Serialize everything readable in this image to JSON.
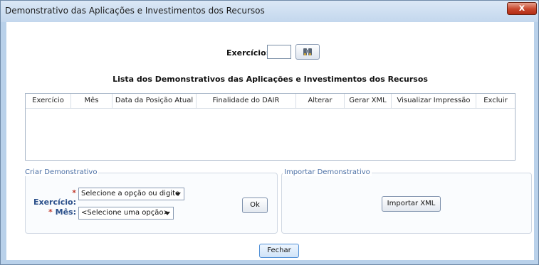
{
  "window": {
    "title": "Demonstrativo das Aplicações e Investimentos dos Recursos",
    "close_label": "x"
  },
  "filter": {
    "exercicio_label": "Exercício:",
    "exercicio_value": "",
    "search_icon": "binoculars-icon"
  },
  "list": {
    "title": "Lista dos Demonstrativos das Aplicações e Investimentos dos Recursos",
    "columns": [
      "Exercício",
      "Mês",
      "Data da Posição Atual",
      "Finalidade do DAIR",
      "Alterar",
      "Gerar XML",
      "Visualizar Impressão",
      "Excluir"
    ],
    "rows": []
  },
  "criar": {
    "title": "Criar Demonstrativo",
    "exercicio_label": "Exercício:",
    "exercicio_value": "Selecione a opção ou digite",
    "mes_label": "Mês:",
    "mes_value": "<Selecione uma opção>",
    "required_mark": "*",
    "ok_label": "Ok"
  },
  "importar": {
    "title": "Importar Demonstrativo",
    "button_label": "Importar XML"
  },
  "footer": {
    "fechar_label": "Fechar"
  }
}
